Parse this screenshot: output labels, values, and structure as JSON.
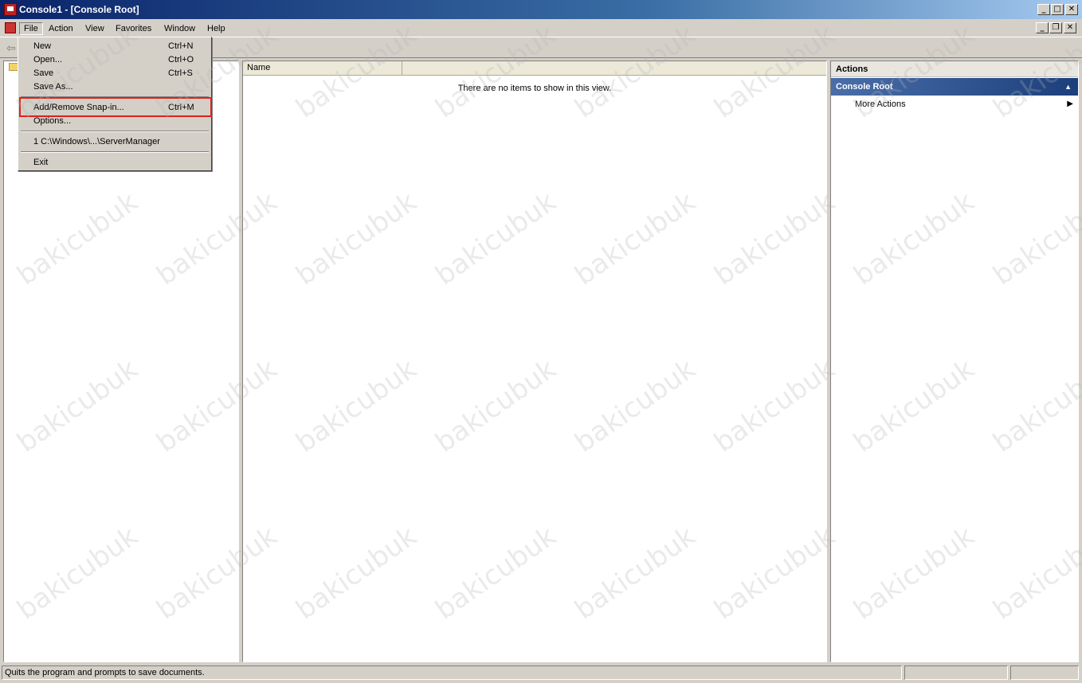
{
  "window": {
    "title": "Console1 - [Console Root]",
    "minimize_glyph": "_",
    "maximize_glyph": "□",
    "close_glyph": "✕",
    "restore_glyph": "❐"
  },
  "menubar": {
    "items": [
      "File",
      "Action",
      "View",
      "Favorites",
      "Window",
      "Help"
    ]
  },
  "toolbar": {
    "back_glyph": "⇦"
  },
  "file_menu": {
    "items": [
      {
        "label": "New",
        "shortcut": "Ctrl+N"
      },
      {
        "label": "Open...",
        "shortcut": "Ctrl+O"
      },
      {
        "label": "Save",
        "shortcut": "Ctrl+S"
      },
      {
        "label": "Save As...",
        "shortcut": ""
      },
      {
        "label": "Add/Remove Snap-in...",
        "shortcut": "Ctrl+M"
      },
      {
        "label": "Options...",
        "shortcut": ""
      },
      {
        "label": "1 C:\\Windows\\...\\ServerManager",
        "shortcut": ""
      },
      {
        "label": "Exit",
        "shortcut": ""
      }
    ]
  },
  "center": {
    "column_name": "Name",
    "empty_message": "There are no items to show in this view."
  },
  "actions": {
    "title": "Actions",
    "group": "Console Root",
    "group_chevron": "▲",
    "more_actions": "More Actions",
    "more_arrow": "▶"
  },
  "statusbar": {
    "text": "Quits the program and prompts to save documents."
  },
  "watermark": "bakicubuk"
}
